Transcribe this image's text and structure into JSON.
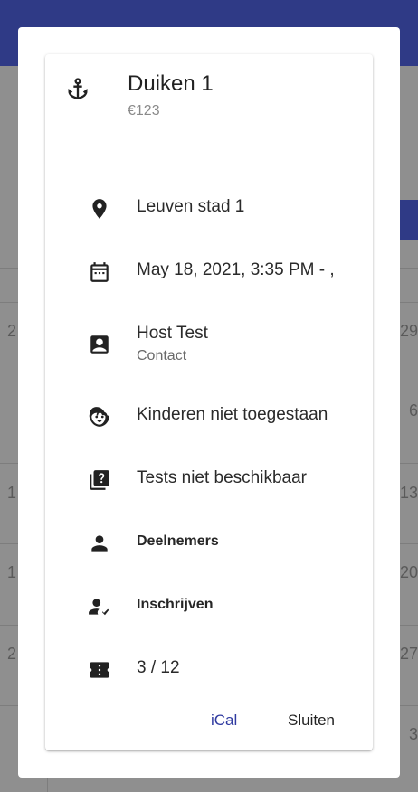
{
  "background": {
    "day_numbers_left": [
      "2",
      "1",
      "1",
      "2"
    ],
    "day_numbers_right": [
      "29",
      "6",
      "13",
      "20",
      "27",
      "3"
    ]
  },
  "dialog": {
    "title": "Duiken 1",
    "price": "€123",
    "location": "Leuven stad 1",
    "datetime": "May 18, 2021, 3:35 PM - ,",
    "host_name": "Host Test",
    "host_label": "Contact",
    "children": "Kinderen niet toegestaan",
    "tests": "Tests niet beschikbaar",
    "participants_label": "Deelnemers",
    "register_label": "Inschrijven",
    "capacity": "3 / 12",
    "ical_button": "iCal",
    "close_button": "Sluiten"
  },
  "icons": {
    "header": "anchor-icon",
    "location": "location-pin-icon",
    "date": "calendar-icon",
    "contact": "contact-card-icon",
    "children": "child-face-icon",
    "tests": "quiz-library-icon",
    "participants": "person-icon",
    "register": "person-check-icon",
    "capacity": "ticket-icon"
  },
  "colors": {
    "primary": "#2f3a86",
    "ical_button": "#2f3aa0"
  }
}
